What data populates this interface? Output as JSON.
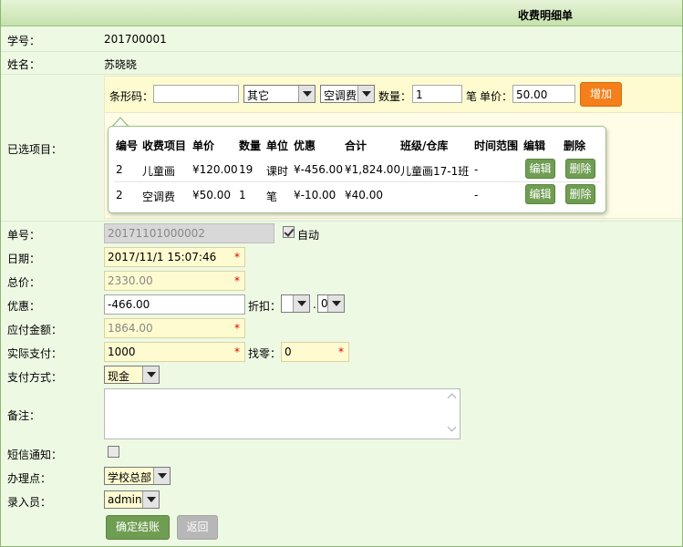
{
  "header": {
    "title": "收费明细单"
  },
  "student": {
    "id_label": "学号：",
    "id_value": "201700001",
    "name_label": "姓名：",
    "name_value": "苏晓晓"
  },
  "selected": {
    "label": "已选项目：",
    "barcode_label": "条形码：",
    "barcode_value": "",
    "type_select": "其它",
    "item_select": "空调费",
    "qty_label": "数量：",
    "qty_value": "1",
    "unit_text": "笔",
    "price_label": "单价：",
    "price_value": "50.00",
    "add_label": "增加",
    "columns": [
      "编号",
      "收费项目",
      "单价",
      "数量",
      "单位",
      "优惠",
      "合计",
      "班级/仓库",
      "时间范围",
      "编辑",
      "删除"
    ],
    "rows": [
      {
        "no": "2",
        "item": "儿童画",
        "price": "¥120.00",
        "qty": "19",
        "unit": "课时",
        "discount": "¥-456.00",
        "total": "¥1,824.00",
        "class": "儿童画17-1班",
        "range": "-",
        "edit": "编辑",
        "del": "删除"
      },
      {
        "no": "2",
        "item": "空调费",
        "price": "¥50.00",
        "qty": "1",
        "unit": "笔",
        "discount": "¥-10.00",
        "total": "¥40.00",
        "class": "",
        "range": "-",
        "edit": "编辑",
        "del": "删除"
      }
    ]
  },
  "form": {
    "order_label": "单号：",
    "order_value": "20171101000002",
    "auto_label": "自动",
    "auto_checked": true,
    "date_label": "日期：",
    "date_value": "2017/11/1 15:07:46",
    "total_label": "总价：",
    "total_value": "2330.00",
    "discount_label": "优惠：",
    "discount_value": "-466.00",
    "rate_label": "折扣：",
    "rate_int": "",
    "rate_dot": ".",
    "rate_dec": "0",
    "payable_label": "应付金额：",
    "payable_value": "1864.00",
    "paid_label": "实际支付：",
    "paid_value": "1000",
    "change_label": "找零：",
    "change_value": "0",
    "paymethod_label": "支付方式：",
    "paymethod_value": "现金",
    "remark_label": "备注：",
    "remark_value": "",
    "sms_label": "短信通知：",
    "sms_checked": false,
    "office_label": "办理点：",
    "office_value": "学校总部",
    "operator_label": "录入员：",
    "operator_value": "admin",
    "required_mark": "*"
  },
  "actions": {
    "confirm_label": "确定结账",
    "back_label": "返回"
  }
}
